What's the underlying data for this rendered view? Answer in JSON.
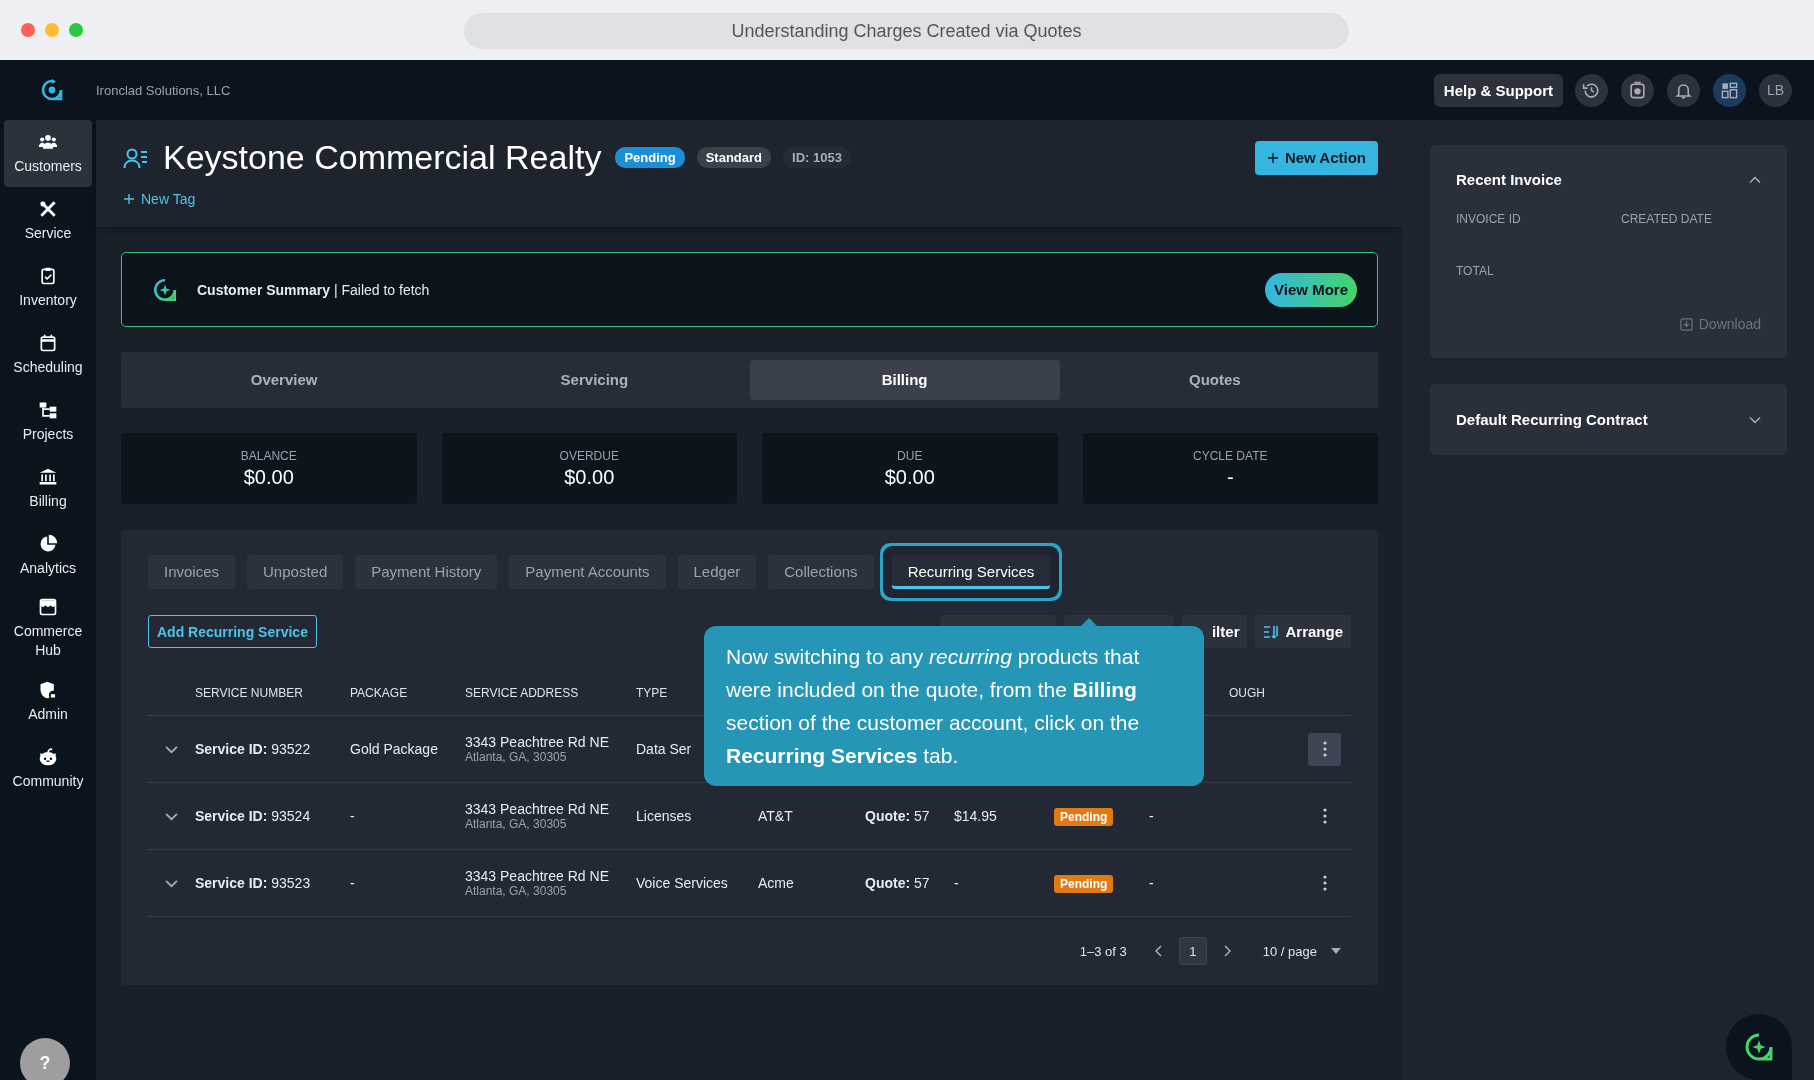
{
  "browser": {
    "title": "Understanding Charges Created via Quotes"
  },
  "topbar": {
    "company": "Ironclad Solutions, LLC",
    "help": "Help & Support",
    "icons": [
      {
        "kind": "history",
        "selected": false
      },
      {
        "kind": "timer",
        "selected": false
      },
      {
        "kind": "bell",
        "selected": false
      },
      {
        "kind": "layout",
        "selected": true
      }
    ],
    "avatar": "LB"
  },
  "sidebar": {
    "items": [
      {
        "label": "Customers",
        "kind": "people",
        "selected": true
      },
      {
        "label": "Service",
        "kind": "tools",
        "selected": false
      },
      {
        "label": "Inventory",
        "kind": "clipboard",
        "selected": false
      },
      {
        "label": "Scheduling",
        "kind": "calendar",
        "selected": false
      },
      {
        "label": "Projects",
        "kind": "hierarchy",
        "selected": false
      },
      {
        "label": "Billing",
        "kind": "bank",
        "selected": false
      },
      {
        "label": "Analytics",
        "kind": "pie",
        "selected": false
      },
      {
        "label": "Commerce Hub",
        "kind": "store",
        "selected": false
      },
      {
        "label": "Admin",
        "kind": "shield",
        "selected": false
      },
      {
        "label": "Community",
        "kind": "critter",
        "selected": false
      }
    ],
    "help": "?"
  },
  "customer": {
    "name": "Keystone Commercial Realty",
    "badges": [
      {
        "text": "Pending",
        "kind": "status"
      },
      {
        "text": "Standard",
        "kind": "tier"
      },
      {
        "text": "ID: 1053",
        "kind": "id"
      }
    ],
    "new_tag": "New Tag",
    "new_action": "New Action"
  },
  "summary": {
    "text": "**Customer Summary** | Failed to fetch",
    "button": "View More"
  },
  "main_tabs": [
    {
      "label": "Overview",
      "selected": false
    },
    {
      "label": "Servicing",
      "selected": false
    },
    {
      "label": "Billing",
      "selected": true
    },
    {
      "label": "Quotes",
      "selected": false
    }
  ],
  "stats": [
    {
      "label": "BALANCE",
      "value": "$0.00"
    },
    {
      "label": "OVERDUE",
      "value": "$0.00"
    },
    {
      "label": "DUE",
      "value": "$0.00"
    },
    {
      "label": "CYCLE DATE",
      "value": "-"
    }
  ],
  "billing_tabs": [
    {
      "label": "Invoices",
      "selected": false,
      "spotlight": false
    },
    {
      "label": "Unposted",
      "selected": false,
      "spotlight": false
    },
    {
      "label": "Payment History",
      "selected": false,
      "spotlight": false
    },
    {
      "label": "Payment Accounts",
      "selected": false,
      "spotlight": false
    },
    {
      "label": "Ledger",
      "selected": false,
      "spotlight": false
    },
    {
      "label": "Collections",
      "selected": false,
      "spotlight": false
    },
    {
      "label": "Recurring Services",
      "selected": true,
      "spotlight": true
    }
  ],
  "toolbar": {
    "add": "Add Recurring Service",
    "filter": "ilter",
    "arrange": "Arrange"
  },
  "table": {
    "columns": {
      "service_number": "SERVICE NUMBER",
      "package": "PACKAGE",
      "service_address": "SERVICE ADDRESS",
      "type": "TYPE",
      "column_10": "OUGH"
    },
    "rows": [
      {
        "expanded": false,
        "menu_highlighted": true,
        "service_number": "**Service ID:** 93522",
        "package": "Gold Package",
        "address": "3343 Peachtree Rd NE",
        "city": "Atlanta, GA, 30305",
        "type": "Data Ser"
      },
      {
        "expanded": false,
        "menu_highlighted": false,
        "service_number": "**Service ID:** 93524",
        "package": "-",
        "address": "3343 Peachtree Rd NE",
        "city": "Atlanta, GA, 30305",
        "type": "Licenses",
        "column_6": "AT&T",
        "quote": "**Quote:** 57",
        "price": "$14.95",
        "status": "Pending",
        "column_10": "-"
      },
      {
        "expanded": false,
        "menu_highlighted": false,
        "service_number": "**Service ID:** 93523",
        "package": "-",
        "address": "3343 Peachtree Rd NE",
        "city": "Atlanta, GA, 30305",
        "type": "Voice Services",
        "column_6": "Acme",
        "quote": "**Quote:** 57",
        "price": "-",
        "status": "Pending",
        "column_10": "-"
      }
    ]
  },
  "pagination": {
    "range": "1–3 of 3",
    "pages": [
      {
        "label": "1",
        "selected": true
      }
    ],
    "page_size": "10 / page"
  },
  "tooltip": {
    "text": "Now switching to any *recurring* products that were included on the quote, from the **Billing** section of the customer account, click on the **Recurring Services** tab."
  },
  "recent_invoice": {
    "title": "Recent Invoice",
    "expanded": true,
    "fields": [
      "INVOICE ID",
      "CREATED DATE",
      "TOTAL"
    ],
    "download": "Download",
    "download_disabled": true
  },
  "contract": {
    "title": "Default Recurring Contract",
    "expanded": false
  }
}
